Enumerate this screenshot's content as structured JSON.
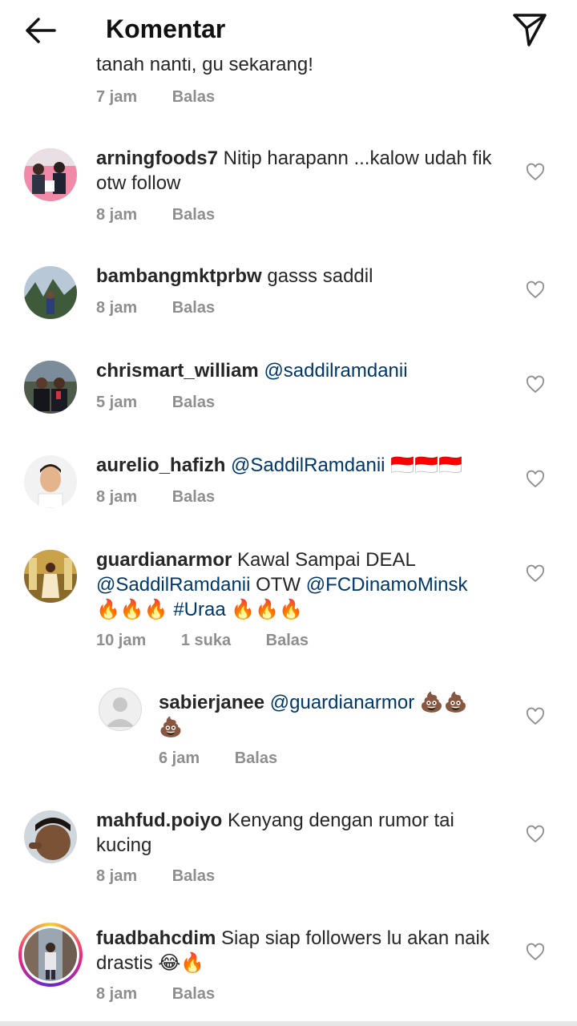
{
  "header": {
    "title": "Komentar"
  },
  "top_partial": {
    "text": "tanah nanti, gu sekarang!",
    "time": "7 jam",
    "reply": "Balas"
  },
  "comments": [
    {
      "user": "arningfoods7",
      "text": " Nitip harapann ...kalow udah fik otw follow",
      "time": "8 jam",
      "reply": "Balas"
    },
    {
      "user": "bambangmktprbw",
      "text": " gasss saddil",
      "time": "8 jam",
      "reply": "Balas"
    },
    {
      "user": "chrismart_william",
      "mention": "@saddilramdanii",
      "time": "5 jam",
      "reply": "Balas"
    },
    {
      "user": "aurelio_hafizh",
      "mention": "@SaddilRamdanii",
      "emoji": "🇮🇩🇮🇩🇮🇩",
      "time": "8 jam",
      "reply": "Balas"
    },
    {
      "user": "guardianarmor",
      "text_part1": " Kawal Sampai DEAL",
      "mention1": "@SaddilRamdanii",
      "text_part2": " OTW ",
      "mention2": "@FCDinamoMinsk",
      "emoji1": "🔥🔥🔥",
      "hashtag": "#Uraa",
      "emoji2": "🔥🔥🔥",
      "time": "10 jam",
      "likes": "1 suka",
      "reply": "Balas"
    },
    {
      "user": "sabierjanee",
      "mention": "@guardianarmor",
      "emoji": "💩💩 💩",
      "time": "6 jam",
      "reply": "Balas"
    },
    {
      "user": "mahfud.poiyo",
      "text": " Kenyang dengan rumor tai kucing",
      "time": "8 jam",
      "reply": "Balas"
    },
    {
      "user": "fuadbahcdim",
      "text": " Siap siap followers lu akan naik drastis ",
      "emoji": "😂🔥",
      "time": "8 jam",
      "reply": "Balas"
    }
  ]
}
